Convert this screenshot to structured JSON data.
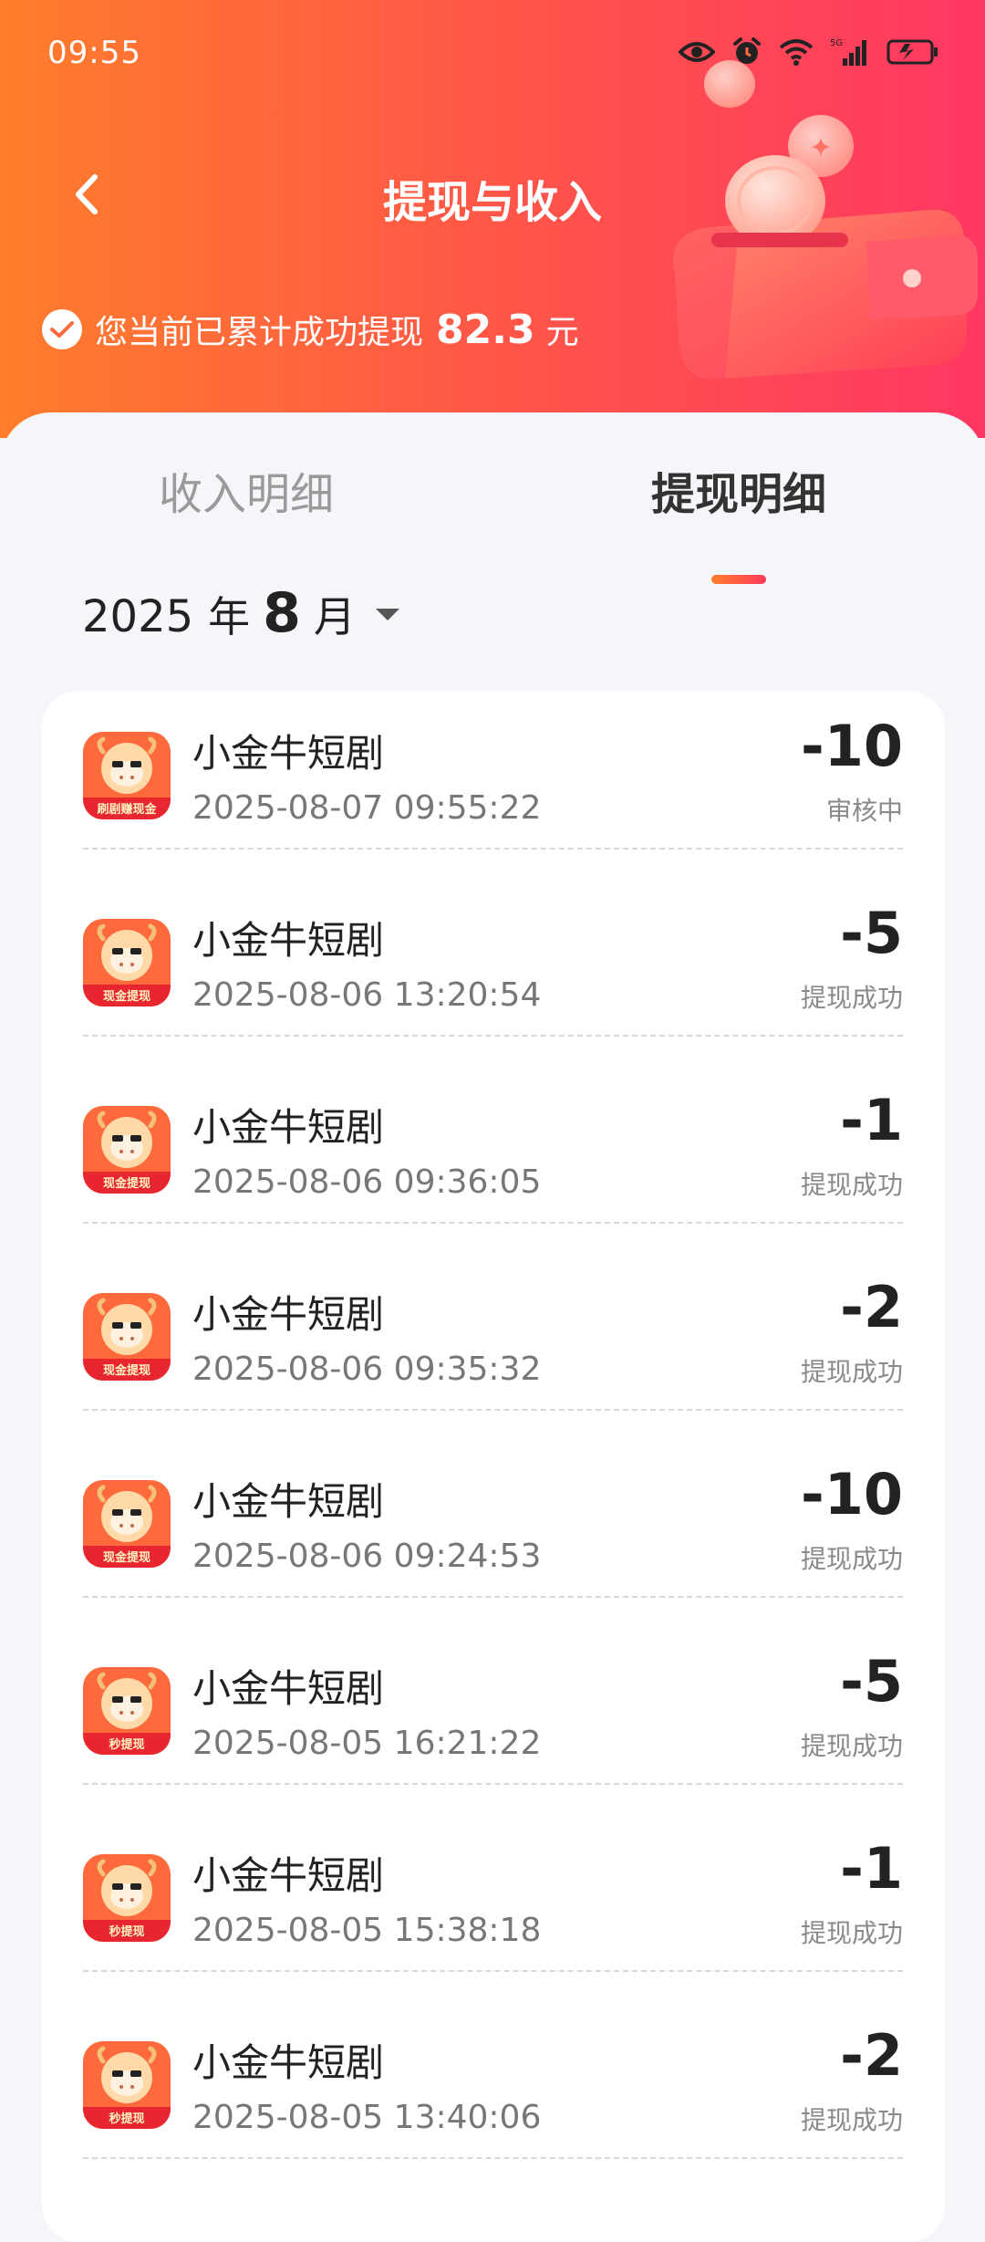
{
  "status_bar": {
    "time": "09:55",
    "icons": [
      "eye-icon",
      "alarm-icon",
      "wifi-icon",
      "signal-5g-icon",
      "battery-charging-icon"
    ],
    "network_label": "5G"
  },
  "header": {
    "title": "提现与收入",
    "summary_prefix": "您当前已累计成功提现",
    "summary_amount": "82.3",
    "summary_unit": "元"
  },
  "tabs": [
    {
      "label": "收入明细",
      "active": false
    },
    {
      "label": "提现明细",
      "active": true
    }
  ],
  "month_picker": {
    "year": "2025",
    "year_label": "年",
    "month": "8",
    "month_label": "月"
  },
  "records": [
    {
      "title": "小金牛短剧",
      "time": "2025-08-07 09:55:22",
      "amount": "-10",
      "status": "审核中",
      "icon_badge": "刷剧赚现金"
    },
    {
      "title": "小金牛短剧",
      "time": "2025-08-06 13:20:54",
      "amount": "-5",
      "status": "提现成功",
      "icon_badge": "现金提现"
    },
    {
      "title": "小金牛短剧",
      "time": "2025-08-06 09:36:05",
      "amount": "-1",
      "status": "提现成功",
      "icon_badge": "现金提现"
    },
    {
      "title": "小金牛短剧",
      "time": "2025-08-06 09:35:32",
      "amount": "-2",
      "status": "提现成功",
      "icon_badge": "现金提现"
    },
    {
      "title": "小金牛短剧",
      "time": "2025-08-06 09:24:53",
      "amount": "-10",
      "status": "提现成功",
      "icon_badge": "现金提现"
    },
    {
      "title": "小金牛短剧",
      "time": "2025-08-05 16:21:22",
      "amount": "-5",
      "status": "提现成功",
      "icon_badge": "秒提现"
    },
    {
      "title": "小金牛短剧",
      "time": "2025-08-05 15:38:18",
      "amount": "-1",
      "status": "提现成功",
      "icon_badge": "秒提现"
    },
    {
      "title": "小金牛短剧",
      "time": "2025-08-05 13:40:06",
      "amount": "-2",
      "status": "提现成功",
      "icon_badge": "秒提现"
    }
  ],
  "colors": {
    "header_start": "#ff7d2c",
    "header_end": "#ff3763",
    "tab_indicator": "#ff5a45",
    "background": "#f5f6fa"
  }
}
